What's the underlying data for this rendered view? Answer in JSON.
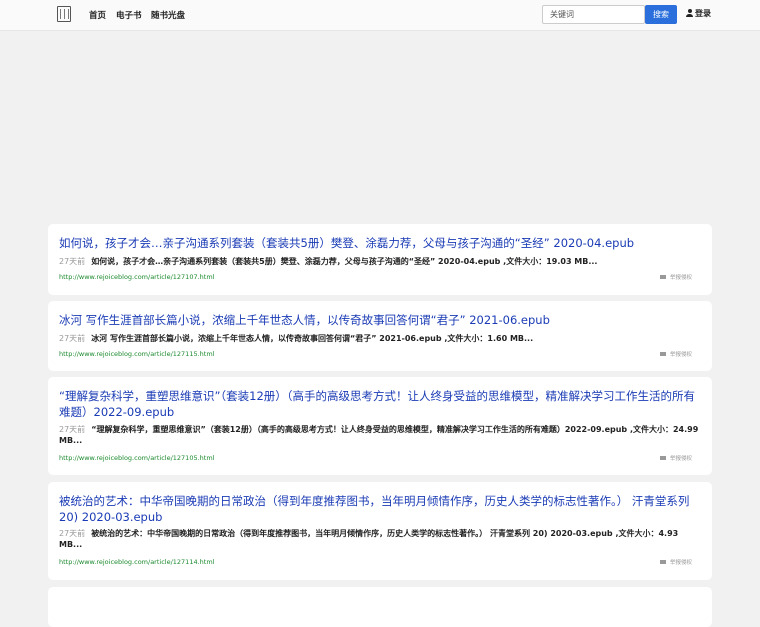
{
  "header": {
    "nav": [
      "首页",
      "电子书",
      "随书光盘"
    ],
    "search_placeholder": "关键词",
    "search_button": "搜索",
    "login": "登录"
  },
  "results": [
    {
      "title": "如何说，孩子才会…亲子沟通系列套装（套装共5册）樊登、涂磊力荐，父母与孩子沟通的“圣经” 2020-04.epub",
      "ago": "27天前",
      "desc": "如何说，孩子才会…亲子沟通系列套装（套装共5册）樊登、涂磊力荐，父母与孩子沟通的“圣经” 2020-04.epub ,文件大小：19.03 MB...",
      "url": "http://www.rejoiceblog.com/article/127107.html",
      "report": "举报侵权"
    },
    {
      "title": "冰河 写作生涯首部长篇小说，浓缩上千年世态人情，以传奇故事回答何谓“君子” 2021-06.epub",
      "ago": "27天前",
      "desc": "冰河 写作生涯首部长篇小说，浓缩上千年世态人情，以传奇故事回答何谓“君子” 2021-06.epub ,文件大小：1.60 MB...",
      "url": "http://www.rejoiceblog.com/article/127115.html",
      "report": "举报侵权"
    },
    {
      "title": "“理解复杂科学，重塑思维意识”（套装12册）（高手的高级思考方式！让人终身受益的思维模型，精准解决学习工作生活的所有难题）2022-09.epub",
      "ago": "27天前",
      "desc": "“理解复杂科学，重塑思维意识”（套装12册）（高手的高级思考方式！让人终身受益的思维模型，精准解决学习工作生活的所有难题）2022-09.epub ,文件大小：24.99 MB...",
      "url": "http://www.rejoiceblog.com/article/127105.html",
      "report": "举报侵权"
    },
    {
      "title": "被统治的艺术：中华帝国晚期的日常政治（得到年度推荐图书，当年明月倾情作序，历史人类学的标志性著作。） 汗青堂系列 20) 2020-03.epub",
      "ago": "27天前",
      "desc": "被统治的艺术：中华帝国晚期的日常政治（得到年度推荐图书，当年明月倾情作序，历史人类学的标志性著作。） 汗青堂系列 20) 2020-03.epub ,文件大小：4.93 MB...",
      "url": "http://www.rejoiceblog.com/article/127114.html",
      "report": "举报侵权"
    }
  ]
}
